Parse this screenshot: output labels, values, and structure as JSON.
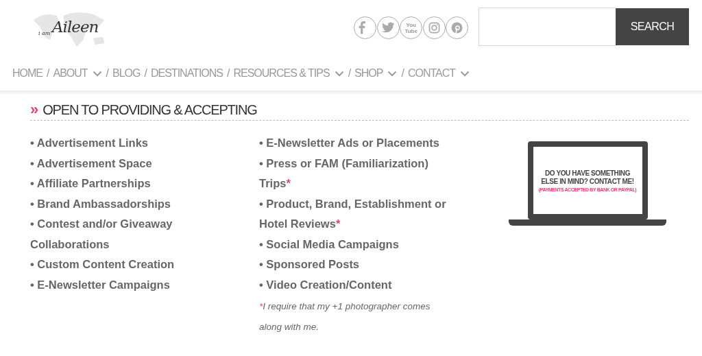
{
  "logo": {
    "prefix": "i am",
    "name": "Aileen"
  },
  "social": [
    {
      "kind": "facebook"
    },
    {
      "kind": "twitter"
    },
    {
      "kind": "youtube",
      "label": "You\nTube"
    },
    {
      "kind": "instagram"
    },
    {
      "kind": "pinterest"
    }
  ],
  "search": {
    "button": "SEARCH"
  },
  "nav": [
    {
      "label": "HOME",
      "has_dropdown": false
    },
    {
      "separator": "/",
      "label": "ABOUT",
      "has_dropdown": true
    },
    {
      "separator": "/",
      "label": "BLOG",
      "has_dropdown": false
    },
    {
      "separator": "/",
      "label": "DESTINATIONS",
      "has_dropdown": false
    },
    {
      "separator": "/",
      "label": "RESOURCES & TIPS",
      "has_dropdown": true
    },
    {
      "separator": "/",
      "label": "SHOP",
      "has_dropdown": true
    },
    {
      "separator": "/",
      "label": "CONTACT",
      "has_dropdown": true
    }
  ],
  "section": {
    "marker": "»",
    "title": "OPEN TO PROVIDING & ACCEPTING"
  },
  "columns": [
    [
      {
        "text": "• Advertisement Links"
      },
      {
        "text": "• Advertisement Space"
      },
      {
        "text": "• Affiliate Partnerships"
      },
      {
        "text": "• Brand Ambassadorships"
      },
      {
        "text": "• Contest and/or Giveaway Collaborations"
      },
      {
        "text": "• Custom Content Creation"
      },
      {
        "text": "• E-Newsletter Campaigns"
      }
    ],
    [
      {
        "text": "• E-Newsletter Ads or Placements"
      },
      {
        "text": "• Press or FAM (Familiarization) Trips",
        "mark": "*"
      },
      {
        "text": "• Product, Brand, Establishment or Hotel Reviews",
        "mark": "*"
      },
      {
        "text": "• Social Media Campaigns"
      },
      {
        "text": "• Sponsored Posts"
      },
      {
        "text": "• Video Creation/Content"
      }
    ]
  ],
  "footnote": {
    "mark": "*",
    "text": "I require that my +1 photographer comes along with me."
  },
  "promo": {
    "headline": "DO YOU HAVE SOMETHING ELSE IN MIND? CONTACT ME!",
    "note": "(PAYMENTS ACCEPTED BY BANK OR PAYPAL)"
  }
}
